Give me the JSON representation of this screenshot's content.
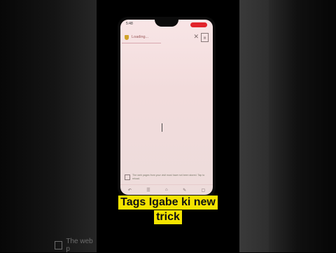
{
  "status_bar": {
    "time": "5:48"
  },
  "browser": {
    "tab_title": "Loading...",
    "offline_note": "The web pages from your visit must have not been stored. Tap to reload."
  },
  "caption": {
    "line1": "Tags Igabe ki new",
    "line2": "trick"
  },
  "background": {
    "ghost_text": "The web p"
  },
  "colors": {
    "caption_bg": "#f5e400",
    "record_pill": "#e2232b",
    "screen_bg": "#f5e1e2"
  },
  "icons": [
    "shield-icon",
    "close-icon",
    "tab-doc-icon",
    "back-icon",
    "forward-icon",
    "home-icon",
    "bookmark-icon",
    "tabs-icon",
    "info-icon"
  ]
}
